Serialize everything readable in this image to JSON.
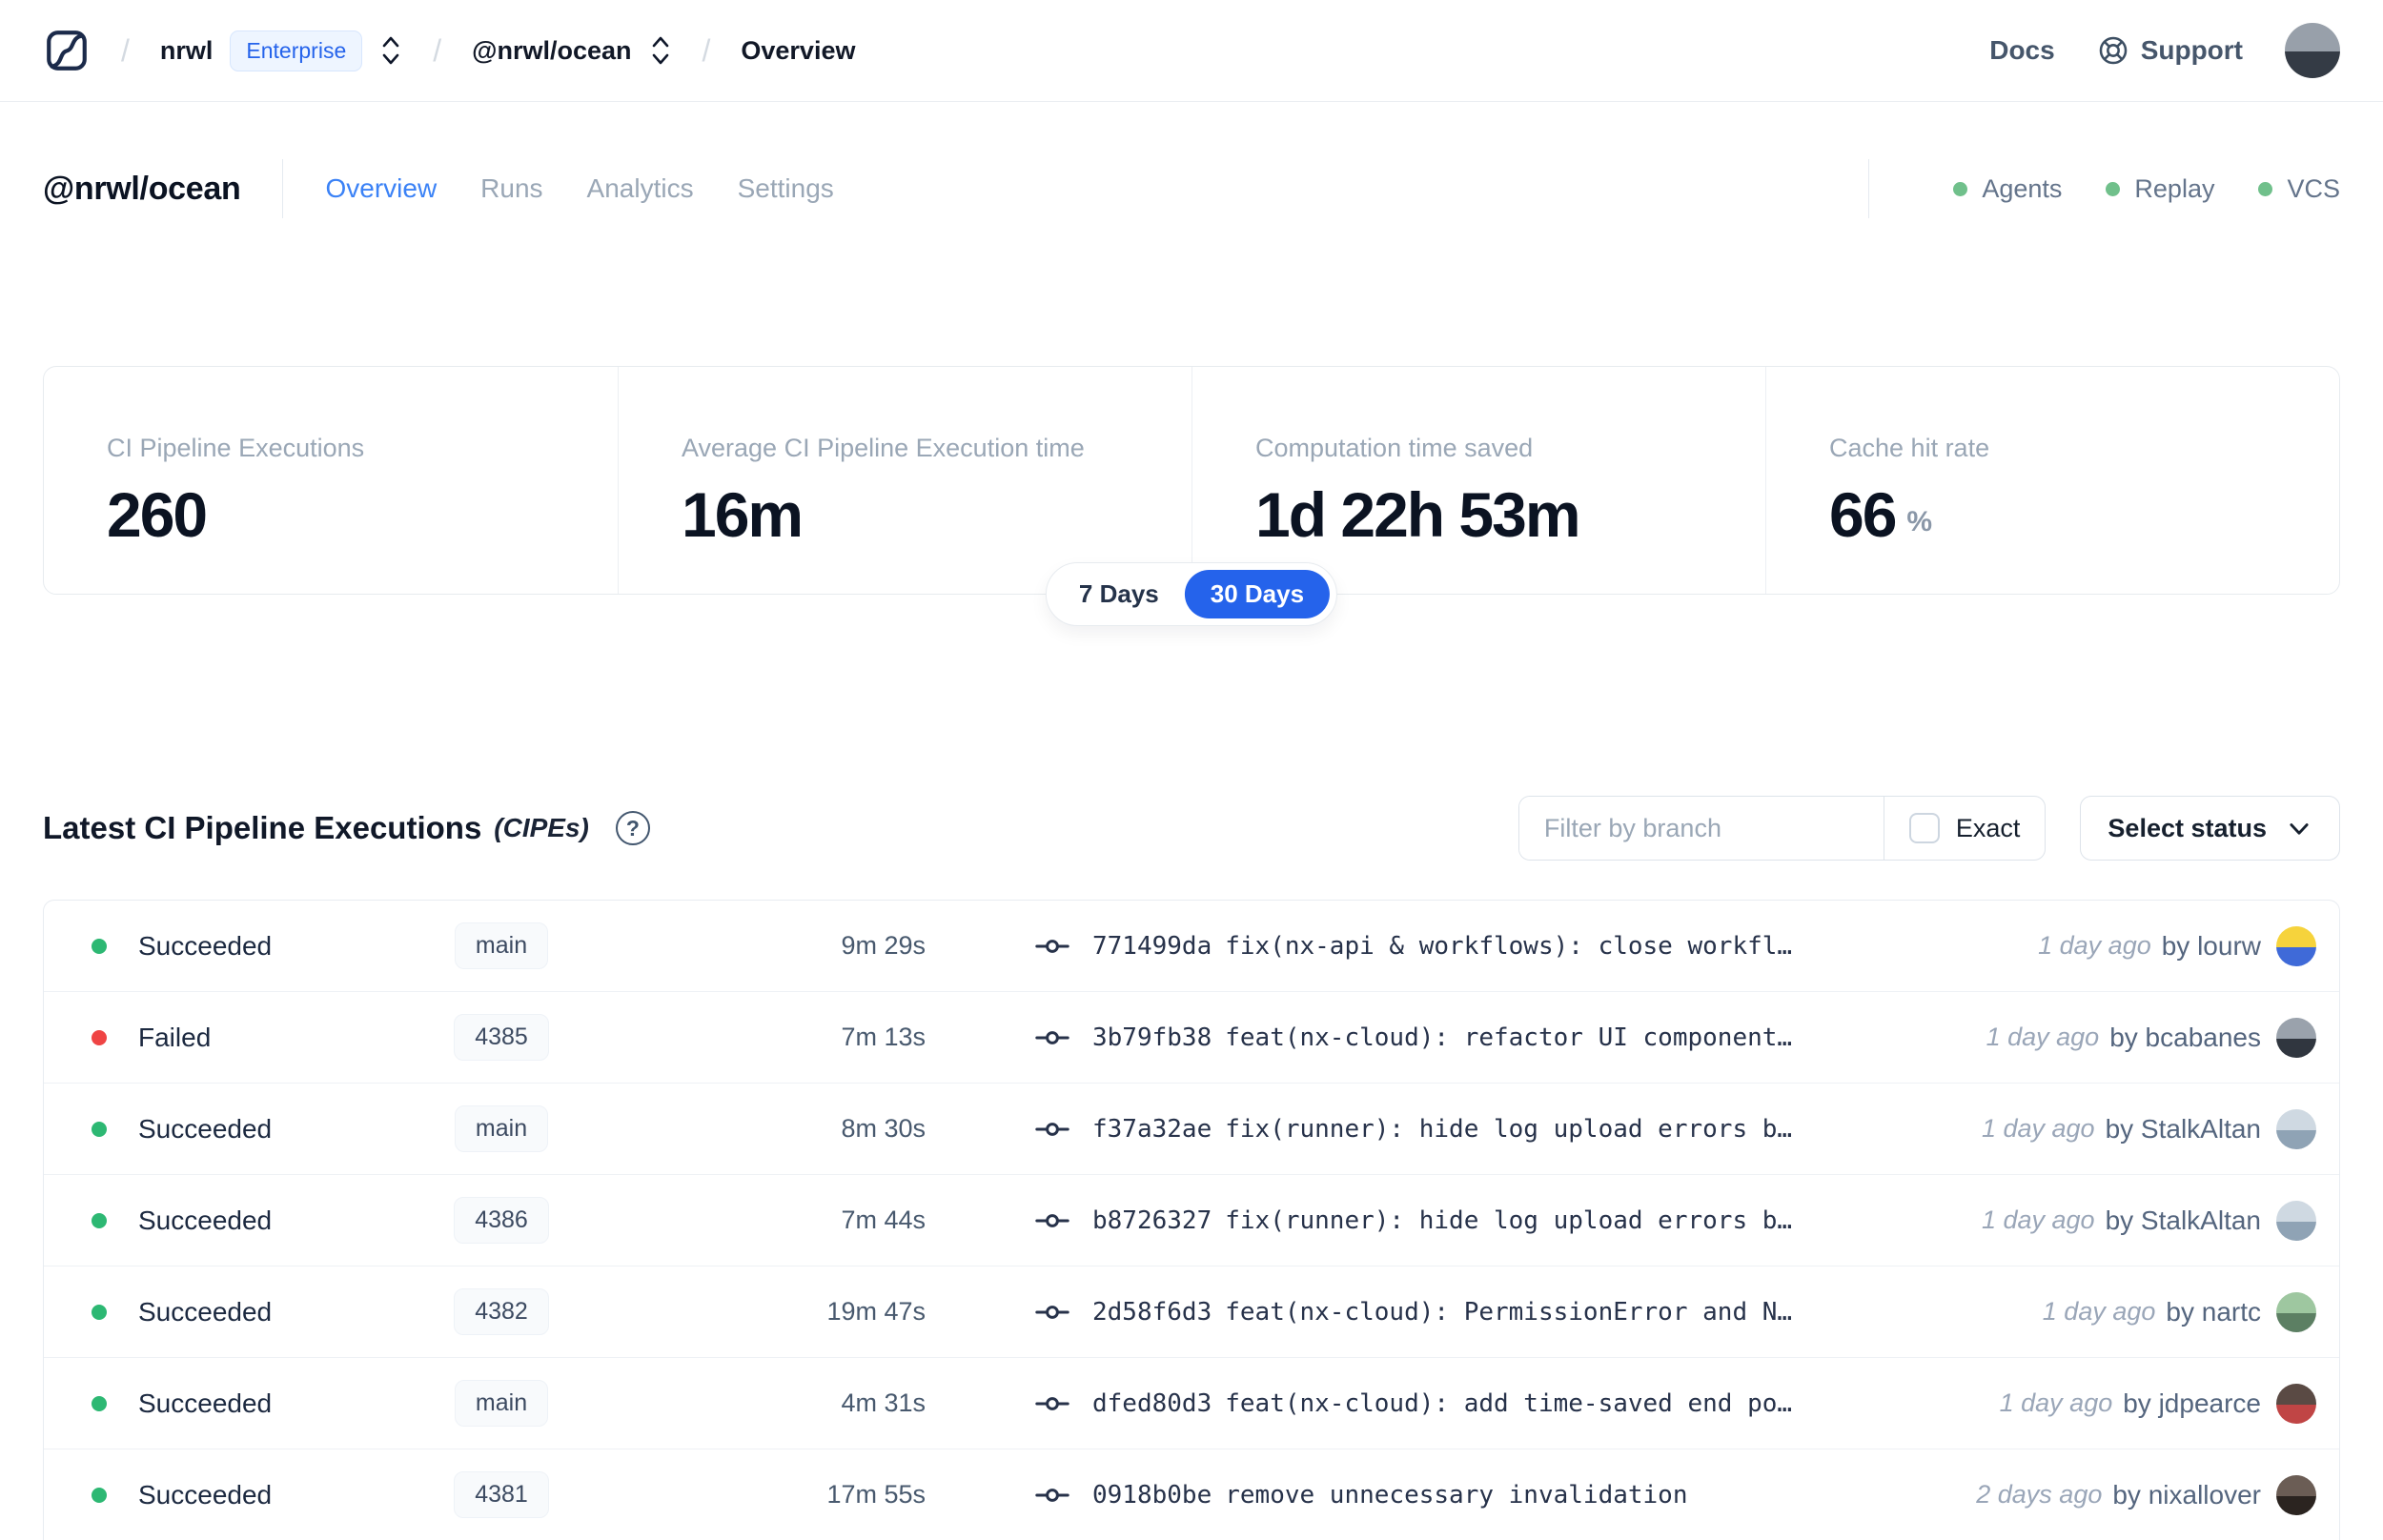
{
  "navbar": {
    "org": "nrwl",
    "plan_badge": "Enterprise",
    "workspace": "@nrwl/ocean",
    "page": "Overview",
    "docs_label": "Docs",
    "support_label": "Support",
    "user_avatar": {
      "c1": "#98a0aa",
      "c2": "#343b45"
    }
  },
  "header": {
    "title": "@nrwl/ocean",
    "tabs": [
      {
        "label": "Overview",
        "active": true
      },
      {
        "label": "Runs",
        "active": false
      },
      {
        "label": "Analytics",
        "active": false
      },
      {
        "label": "Settings",
        "active": false
      }
    ],
    "indicators": [
      {
        "label": "Agents"
      },
      {
        "label": "Replay"
      },
      {
        "label": "VCS"
      }
    ]
  },
  "stats": {
    "cards": [
      {
        "label": "CI Pipeline Executions",
        "value": "260"
      },
      {
        "label": "Average CI Pipeline Execution time",
        "value": "16m"
      },
      {
        "label": "Computation time saved",
        "value": "1d 22h 53m"
      },
      {
        "label": "Cache hit rate",
        "value": "66",
        "unit": "%"
      }
    ],
    "range": {
      "option_7": "7 Days",
      "option_30": "30 Days",
      "selected": "30 Days"
    }
  },
  "cipes": {
    "title": "Latest CI Pipeline Executions",
    "suffix": "(CIPEs)",
    "help_glyph": "?",
    "filter_placeholder": "Filter by branch",
    "exact_label": "Exact",
    "status_label": "Select status",
    "rows": [
      {
        "status": "Succeeded",
        "branch": "main",
        "duration": "9m 29s",
        "commit": "771499da",
        "message": "fix(nx-api & workflows): close workfl…",
        "time": "1 day ago",
        "author": "by lourw",
        "avatar": {
          "c1": "#f6d33c",
          "c2": "#3f6ad8"
        }
      },
      {
        "status": "Failed",
        "branch": "4385",
        "duration": "7m 13s",
        "commit": "3b79fb38",
        "message": "feat(nx-cloud): refactor UI component…",
        "time": "1 day ago",
        "author": "by bcabanes",
        "avatar": {
          "c1": "#9aa2ac",
          "c2": "#30363f"
        }
      },
      {
        "status": "Succeeded",
        "branch": "main",
        "duration": "8m 30s",
        "commit": "f37a32ae",
        "message": "fix(runner): hide log upload errors b…",
        "time": "1 day ago",
        "author": "by StalkAltan",
        "avatar": {
          "c1": "#cfd9e2",
          "c2": "#8fa3b5"
        }
      },
      {
        "status": "Succeeded",
        "branch": "4386",
        "duration": "7m 44s",
        "commit": "b8726327",
        "message": "fix(runner): hide log upload errors b…",
        "time": "1 day ago",
        "author": "by StalkAltan",
        "avatar": {
          "c1": "#cfd9e2",
          "c2": "#8fa3b5"
        }
      },
      {
        "status": "Succeeded",
        "branch": "4382",
        "duration": "19m 47s",
        "commit": "2d58f6d3",
        "message": "feat(nx-cloud): PermissionError and N…",
        "time": "1 day ago",
        "author": "by nartc",
        "avatar": {
          "c1": "#9ec7a0",
          "c2": "#5c7f63"
        }
      },
      {
        "status": "Succeeded",
        "branch": "main",
        "duration": "4m 31s",
        "commit": "dfed80d3",
        "message": "feat(nx-cloud): add time-saved end po…",
        "time": "1 day ago",
        "author": "by jdpearce",
        "avatar": {
          "c1": "#5a4a44",
          "c2": "#c04545"
        }
      },
      {
        "status": "Succeeded",
        "branch": "4381",
        "duration": "17m 55s",
        "commit": "0918b0be",
        "message": "remove unnecessary invalidation",
        "time": "2 days ago",
        "author": "by nixallover",
        "avatar": {
          "c1": "#6b5d55",
          "c2": "#2b2420"
        }
      }
    ]
  },
  "colors": {
    "accent_blue": "#2563eb",
    "active_tab_blue": "#3b82f6",
    "success_green": "#2db873",
    "failed_red": "#ef4444",
    "indicator_green": "#70c08b",
    "enterprise_badge_blue": "#2563eb"
  }
}
